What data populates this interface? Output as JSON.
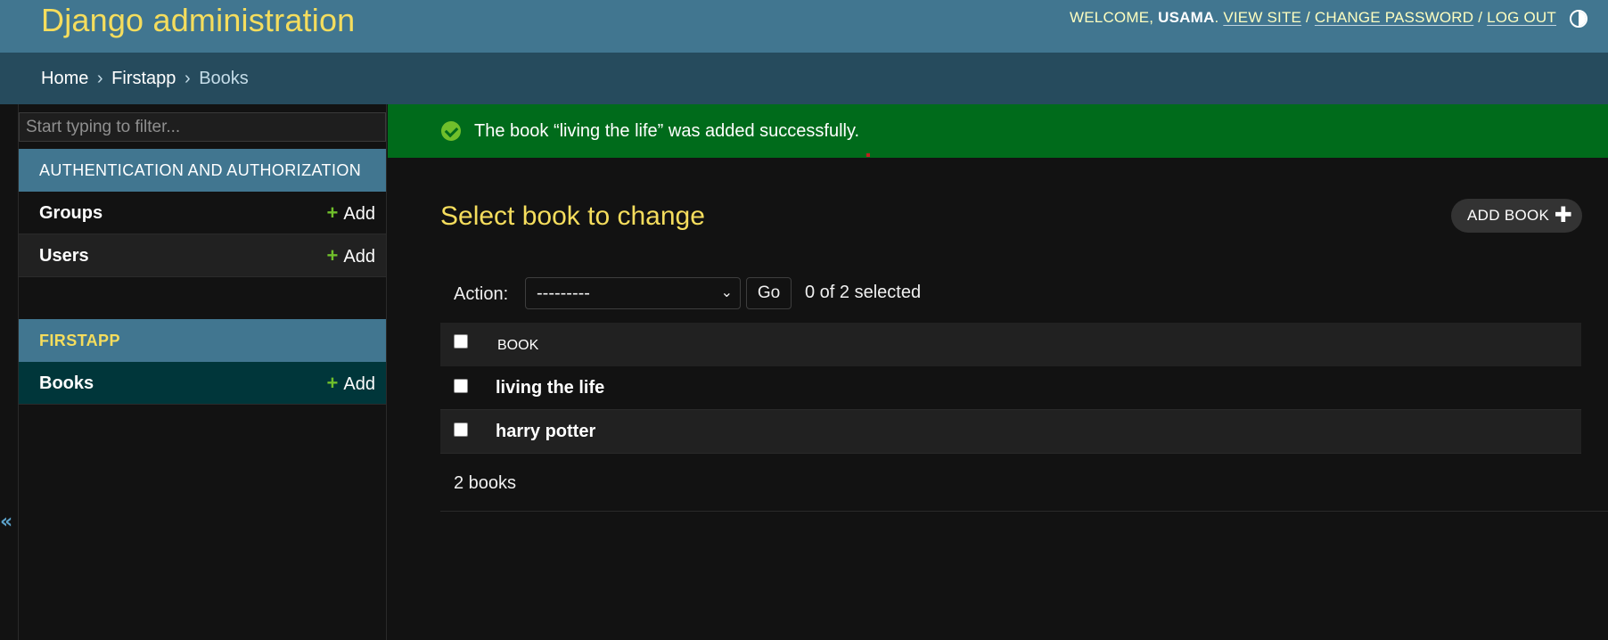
{
  "header": {
    "site_name": "Django administration",
    "welcome_prefix": "WELCOME,",
    "username": "USAMA",
    "view_site": "VIEW SITE",
    "change_password": "CHANGE PASSWORD",
    "log_out": "LOG OUT",
    "separator": "/",
    "theme_toggle_icon": "contrast-icon"
  },
  "breadcrumbs": {
    "items": [
      "Home",
      "Firstapp",
      "Books"
    ],
    "arrow": "›"
  },
  "sidebar": {
    "filter_placeholder": "Start typing to filter...",
    "modules": [
      {
        "caption": "AUTHENTICATION AND AUTHORIZATION",
        "models": [
          {
            "name": "Groups",
            "add_label": "Add"
          },
          {
            "name": "Users",
            "add_label": "Add"
          }
        ]
      },
      {
        "caption": "FIRSTAPP",
        "models": [
          {
            "name": "Books",
            "add_label": "Add",
            "selected": true
          }
        ]
      }
    ],
    "collapse_icon": "«"
  },
  "message": {
    "text": "The book “living the life” was added successfully.",
    "icon": "check-circle-icon"
  },
  "content": {
    "title": "Select book to change",
    "add_button": "ADD BOOK",
    "add_icon": "✚"
  },
  "actions": {
    "label": "Action:",
    "selected_option": "---------",
    "go_label": "Go",
    "counter": "0 of 2 selected"
  },
  "result_list": {
    "column_header": "BOOK",
    "rows": [
      "living the life",
      "harry potter"
    ]
  },
  "paginator": {
    "text": "2 books"
  },
  "colors": {
    "header_bg": "#417690",
    "breadcrumbs_bg": "#264b5d",
    "accent_yellow": "#f5dd5d",
    "success_bg": "#006b1b",
    "add_green": "#70bf2b",
    "selected_row_bg": "#00363a"
  }
}
